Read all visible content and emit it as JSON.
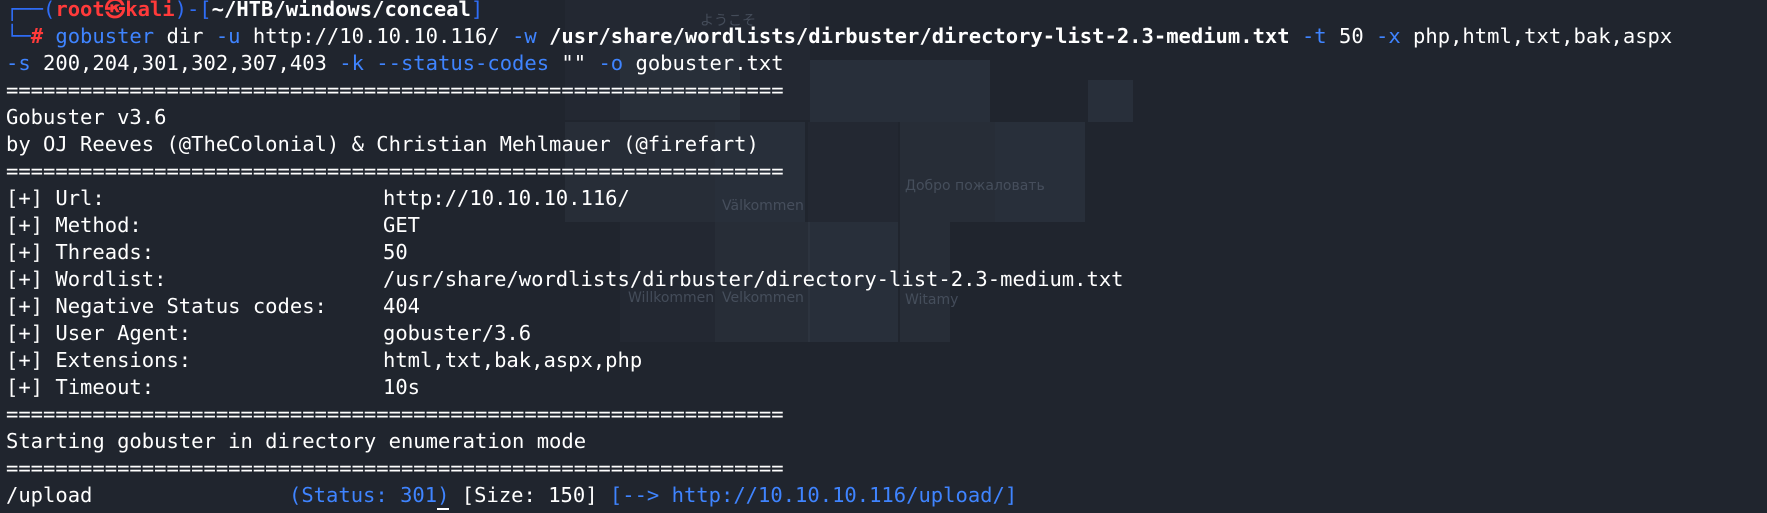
{
  "prompt": {
    "box_top": "┌──(",
    "user": "root㉿kali",
    "sep": ")-[",
    "path": "~/HTB/windows/conceal",
    "close": "]",
    "box_bottom": "└─",
    "hash": "#"
  },
  "command": {
    "tool": "gobuster",
    "sub": " dir ",
    "flag_u": "-u",
    "url": " http://10.10.10.116/ ",
    "flag_w": "-w",
    "wordlist": " /usr/share/wordlists/dirbuster/directory-list-2.3-medium.txt ",
    "flag_t": "-t",
    "threads": " 50 ",
    "flag_x": "-x",
    "ext": " php,html,txt,bak,aspx",
    "flag_s": "-s",
    "codes": " 200,204,301,302,307,403 ",
    "flag_k": "-k",
    "flag_status": " --status-codes",
    "empty": " \"\" ",
    "flag_o": "-o",
    "outfile": " gobuster.txt"
  },
  "separator": "===============================================================",
  "banner": {
    "version": "Gobuster v3.6",
    "authors": "by OJ Reeves (@TheColonial) & Christian Mehlmauer (@firefart)"
  },
  "config": [
    {
      "label": "[+] Url:",
      "value": "http://10.10.10.116/"
    },
    {
      "label": "[+] Method:",
      "value": "GET"
    },
    {
      "label": "[+] Threads:",
      "value": "50"
    },
    {
      "label": "[+] Wordlist:",
      "value": "/usr/share/wordlists/dirbuster/directory-list-2.3-medium.txt"
    },
    {
      "label": "[+] Negative Status codes:",
      "value": "404"
    },
    {
      "label": "[+] User Agent:",
      "value": "gobuster/3.6"
    },
    {
      "label": "[+] Extensions:",
      "value": "html,txt,bak,aspx,php"
    },
    {
      "label": "[+] Timeout:",
      "value": "10s"
    }
  ],
  "mode_line": "Starting gobuster in directory enumeration mode",
  "results": [
    {
      "path": "/upload",
      "status": "(Status: 301)",
      "size": " [Size: 150] ",
      "redirect": "[--> http://10.10.10.116/upload/]"
    }
  ],
  "background_text": [
    "Willkommen",
    "Välkommen",
    "Witamy",
    "Добро пожаловать",
    "Velkommen",
    "ようこそ"
  ],
  "colors": {
    "background": "#20252e",
    "prompt_frame": "#2f6df6",
    "prompt_user": "#ff3a3a",
    "accent": "#3f84ff",
    "text": "#ffffff"
  }
}
